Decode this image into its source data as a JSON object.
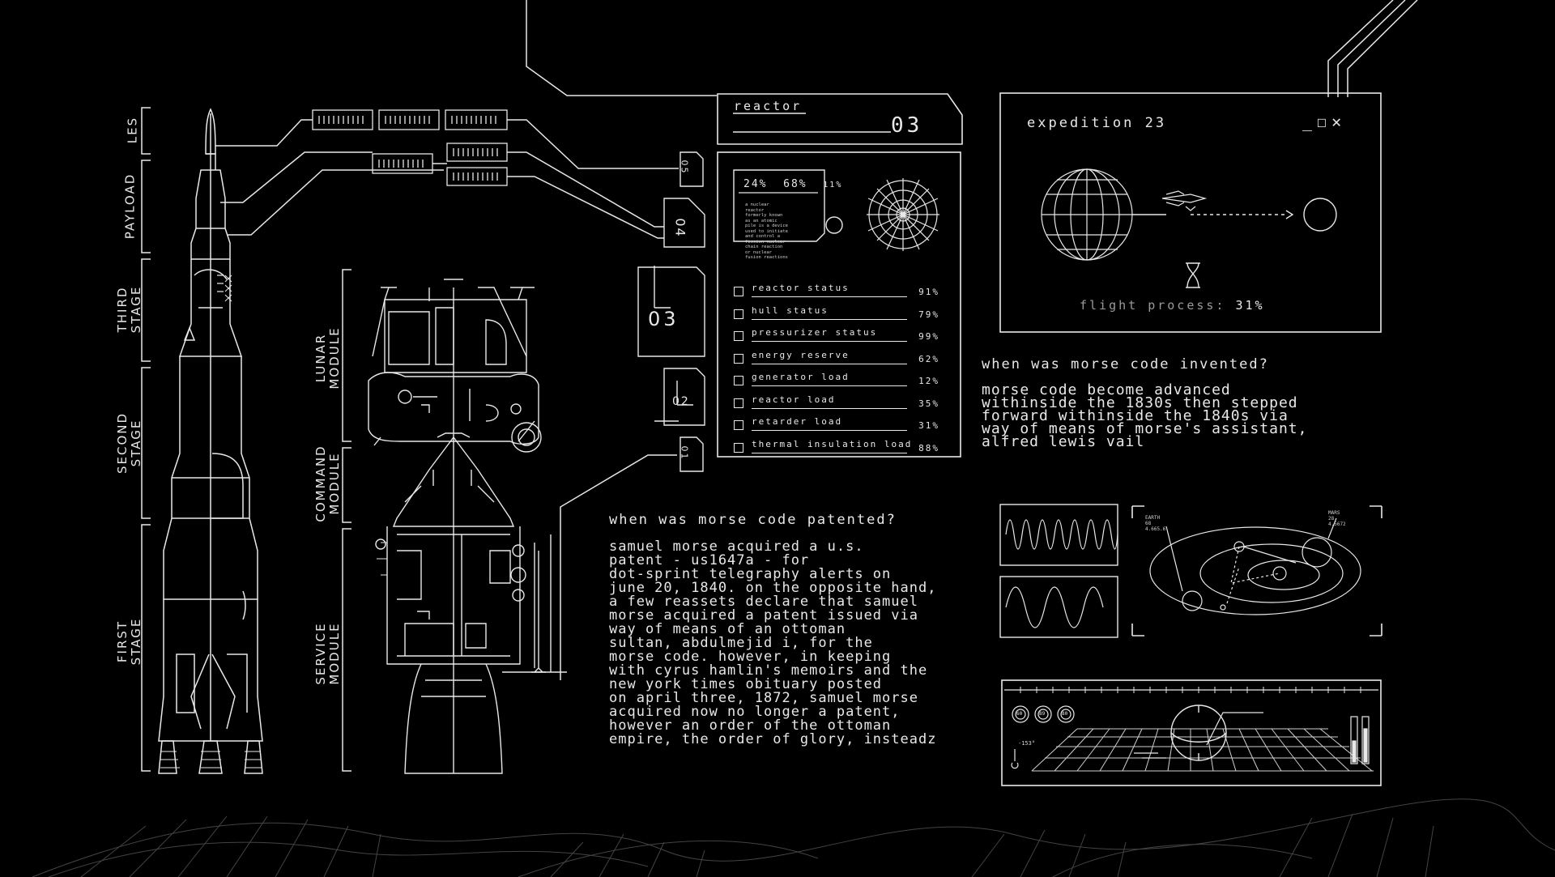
{
  "stage_labels": {
    "les": "LES",
    "payload": "PAYLOAD",
    "third": [
      "THIRD",
      "STAGE"
    ],
    "second": [
      "SECOND",
      "STAGE"
    ],
    "first": [
      "FIRST",
      "STAGE"
    ]
  },
  "module_labels": {
    "lunar": [
      "LUNAR",
      "MODULE"
    ],
    "command": [
      "COMMAND",
      "MODULE"
    ],
    "service": [
      "SERVICE",
      "MODULE"
    ]
  },
  "tags": [
    "05",
    "04",
    "03",
    "02",
    "01"
  ],
  "reactor": {
    "title": "reactor",
    "number": "03",
    "readout": [
      "24%",
      "68%",
      "11%"
    ],
    "description": [
      "a nuclear",
      "reactor",
      "formerly known",
      "as an atomic",
      "pile is a device",
      "used to initiate",
      "and control a",
      "fission nuclear",
      "chain reaction",
      "or nuclear",
      "fusion reactions"
    ],
    "status_items": [
      {
        "name": "reactor status",
        "pct": "91%"
      },
      {
        "name": "hull status",
        "pct": "79%"
      },
      {
        "name": "pressurizer status",
        "pct": "99%"
      },
      {
        "name": "energy reserve",
        "pct": "62%"
      },
      {
        "name": "generator load",
        "pct": "12%"
      },
      {
        "name": "reactor load",
        "pct": "35%"
      },
      {
        "name": "retarder load",
        "pct": "31%"
      },
      {
        "name": "thermal insulation load",
        "pct": "88%"
      }
    ]
  },
  "expedition": {
    "title": "expedition 23",
    "controls": [
      "_",
      "☐",
      "✕"
    ],
    "flight_label": "flight process:",
    "flight_value": "31%",
    "flight_progress": 0.31
  },
  "q1": {
    "question": "when was morse code invented?",
    "answer": [
      "morse code become advanced",
      "withinside the 1830s then stepped",
      "forward withinside the 1840s via",
      "way of means of morse's assistant,",
      "alfred lewis vail"
    ]
  },
  "q2": {
    "question": "when was morse code patented?",
    "answer": [
      "samuel morse acquired a u.s.",
      "patent - us1647a - for",
      "dot-sprint telegraphy alerts on",
      "june 20, 1840. on the opposite hand,",
      "a few reassets declare that samuel",
      "morse acquired a patent issued via",
      "way of means of an ottoman",
      "sultan, abdulmejid i, for the",
      "morse code. however, in keeping",
      "with cyrus hamlin's memoirs and the",
      "new york times obituary posted",
      "on april three, 1872, samuel morse",
      "acquired now no longer a patent,",
      "however an order of the ottoman",
      "empire, the order of glory, insteadz"
    ]
  },
  "orbit_panel": {
    "earth": [
      "EARTH",
      "68",
      "4.665.6"
    ],
    "mars": [
      "MARS",
      "28",
      "4.5672"
    ]
  },
  "terrain_panel": {
    "temp": "-153°",
    "dials": [
      "60",
      "89",
      "80"
    ]
  }
}
